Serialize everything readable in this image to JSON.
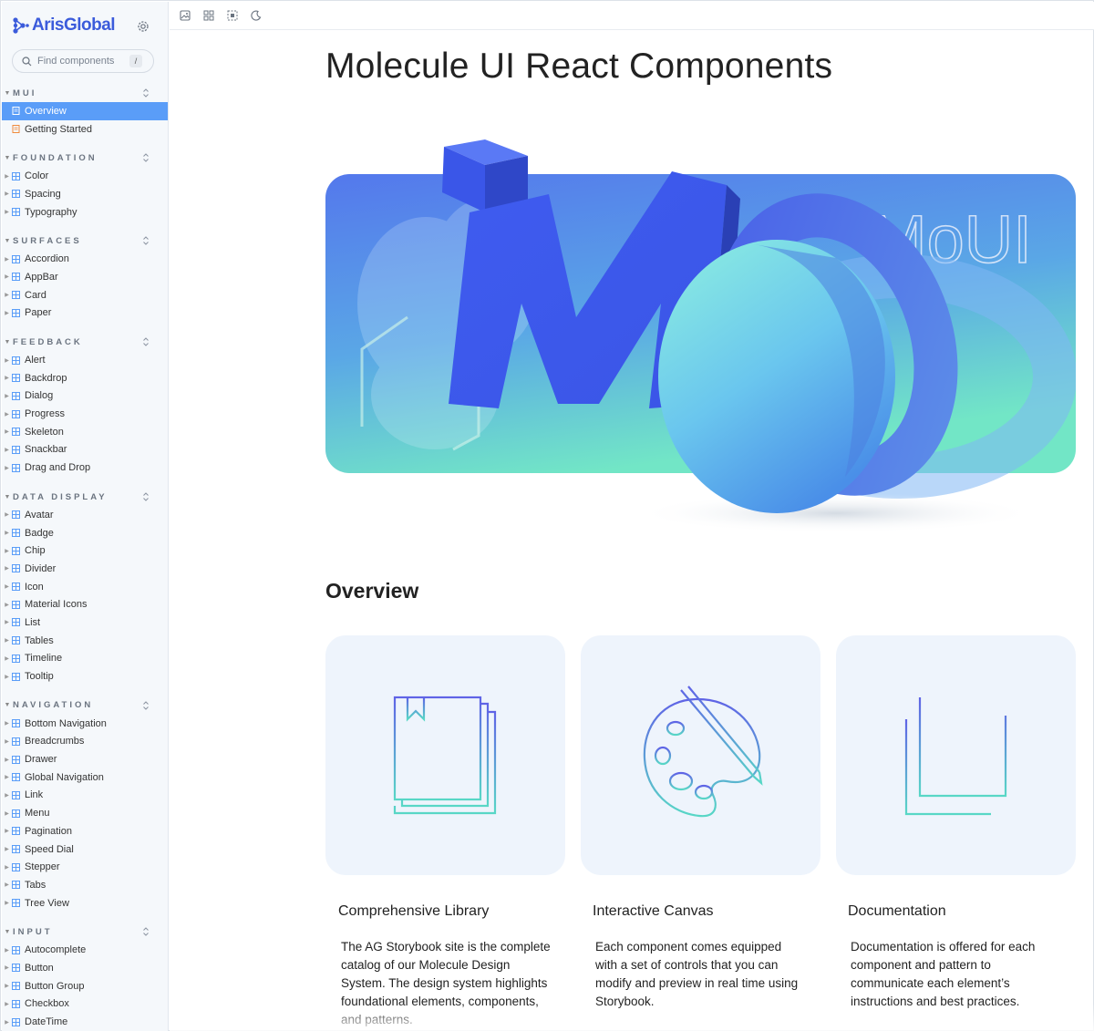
{
  "brand": {
    "name": "ArisGlobal"
  },
  "search": {
    "placeholder": "Find components",
    "shortcut": "/"
  },
  "sections": [
    {
      "title": "MUI",
      "items": [
        {
          "label": "Overview",
          "kind": "doc",
          "active": true
        },
        {
          "label": "Getting Started",
          "kind": "doc",
          "active": false
        }
      ]
    },
    {
      "title": "FOUNDATION",
      "items": [
        {
          "label": "Color"
        },
        {
          "label": "Spacing"
        },
        {
          "label": "Typography"
        }
      ]
    },
    {
      "title": "SURFACES",
      "items": [
        {
          "label": "Accordion"
        },
        {
          "label": "AppBar"
        },
        {
          "label": "Card"
        },
        {
          "label": "Paper"
        }
      ]
    },
    {
      "title": "FEEDBACK",
      "items": [
        {
          "label": "Alert"
        },
        {
          "label": "Backdrop"
        },
        {
          "label": "Dialog"
        },
        {
          "label": "Progress"
        },
        {
          "label": "Skeleton"
        },
        {
          "label": "Snackbar"
        },
        {
          "label": "Drag and Drop"
        }
      ]
    },
    {
      "title": "DATA DISPLAY",
      "items": [
        {
          "label": "Avatar"
        },
        {
          "label": "Badge"
        },
        {
          "label": "Chip"
        },
        {
          "label": "Divider"
        },
        {
          "label": "Icon"
        },
        {
          "label": "Material Icons"
        },
        {
          "label": "List"
        },
        {
          "label": "Tables"
        },
        {
          "label": "Timeline"
        },
        {
          "label": "Tooltip"
        }
      ]
    },
    {
      "title": "NAVIGATION",
      "items": [
        {
          "label": "Bottom Navigation"
        },
        {
          "label": "Breadcrumbs"
        },
        {
          "label": "Drawer"
        },
        {
          "label": "Global Navigation"
        },
        {
          "label": "Link"
        },
        {
          "label": "Menu"
        },
        {
          "label": "Pagination"
        },
        {
          "label": "Speed Dial"
        },
        {
          "label": "Stepper"
        },
        {
          "label": "Tabs"
        },
        {
          "label": "Tree View"
        }
      ]
    },
    {
      "title": "INPUT",
      "items": [
        {
          "label": "Autocomplete"
        },
        {
          "label": "Button"
        },
        {
          "label": "Button Group"
        },
        {
          "label": "Checkbox"
        },
        {
          "label": "DateTime"
        }
      ]
    }
  ],
  "toolbar": {
    "icons": [
      "image-icon",
      "grid-icon",
      "outline-icon",
      "moon-icon"
    ]
  },
  "main": {
    "title": "Molecule UI React Components",
    "hero_wordmark": "MoUI",
    "overview_title": "Overview",
    "cards": [
      {
        "title": "Comprehensive Library",
        "text": "The AG Storybook site is the complete catalog of our Molecule Design System. The design system highlights foundational elements, components, and patterns."
      },
      {
        "title": "Interactive Canvas",
        "text": "Each component comes equipped with a set of controls that you can modify and preview in real time using Storybook."
      },
      {
        "title": "Documentation",
        "text": "Documentation is offered for each component and pattern to communicate each element’s instructions and best practices."
      }
    ]
  },
  "colors": {
    "accent": "#5a9df8",
    "brand": "#3b5bdb",
    "card_bg": "#eef4fc",
    "gradient_start": "#5b7bea",
    "gradient_end": "#6fe0c8"
  }
}
